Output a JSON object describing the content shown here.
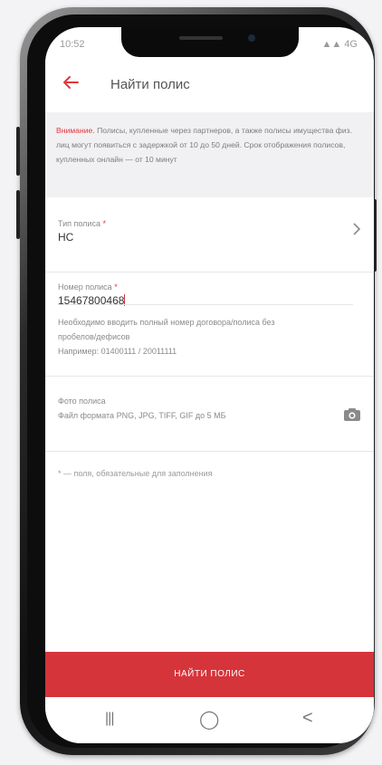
{
  "status": {
    "time": "10:52",
    "right": "▲▲ 4G"
  },
  "appbar": {
    "title": "Найти полис"
  },
  "notice": {
    "prefix": "Внимание.",
    "text": "Полисы, купленные через партнеров, а также полисы имущества физ. лиц могут появиться с задержкой от 10 до 50 дней. Срок отображения полисов, купленных онлайн — от 10 минут"
  },
  "form": {
    "policy_type_label": "Тип полиса",
    "policy_type_value": "НС",
    "policy_number_label": "Номер полиса",
    "policy_number_value": "15467800468",
    "helper_line1": "Необходимо вводить полный номер договора/полиса без",
    "helper_line2": "пробелов/дефисов",
    "helper_example": "Например: 01400111 / 20011111",
    "photo_label": "Фото полиса",
    "photo_hint": "Файл формата PNG, JPG, TIFF, GIF до 5 МБ"
  },
  "footnote": "* — поля, обязательные для заполнения",
  "cta": {
    "label": "НАЙТИ ПОЛИС"
  },
  "navbar": {
    "recent": "|||",
    "home": "◯",
    "back": "<"
  },
  "colors": {
    "accent": "#e0383f",
    "cta": "#d5343b"
  },
  "icons": {
    "back": "arrow-left-icon",
    "chevron": "chevron-right-icon",
    "camera": "camera-icon"
  }
}
